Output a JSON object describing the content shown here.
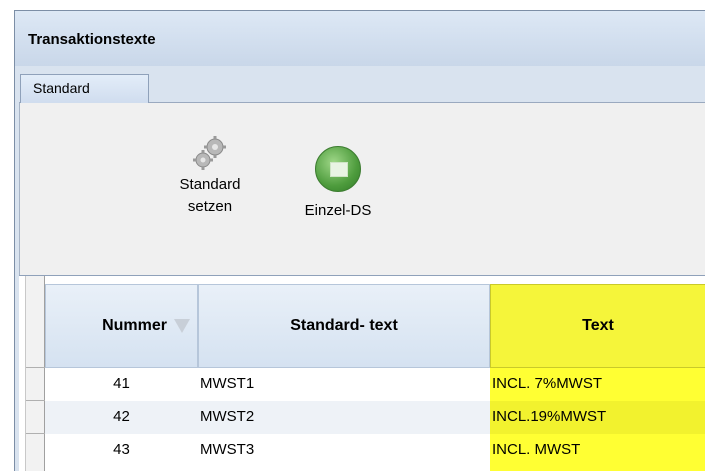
{
  "window": {
    "title": "Transaktionstexte"
  },
  "tabs": [
    {
      "label": "Standard"
    }
  ],
  "toolbar": {
    "standard_setzen_line1": "Standard",
    "standard_setzen_line2": "setzen",
    "einzel_ds": "Einzel-DS"
  },
  "table": {
    "columns": [
      "Nummer",
      "Standard- text",
      "Text"
    ],
    "rows": [
      {
        "nummer": "41",
        "standard_text": "MWST1",
        "text": "INCL. 7%MWST"
      },
      {
        "nummer": "42",
        "standard_text": "MWST2",
        "text": "INCL.19%MWST"
      },
      {
        "nummer": "43",
        "standard_text": "MWST3",
        "text": "INCL. MWST"
      }
    ]
  },
  "colors": {
    "highlight_column": "#ffff33",
    "header_blue": "#d5e2f1",
    "title_bar": "#c9d7e9"
  }
}
